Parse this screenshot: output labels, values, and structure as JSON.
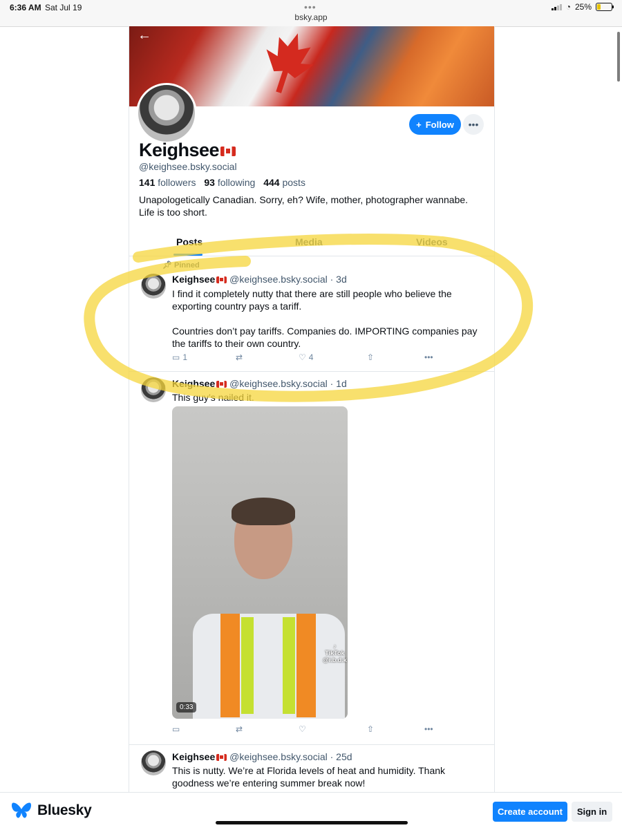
{
  "status_bar": {
    "time": "6:36 AM",
    "date": "Sat Jul 19",
    "dots": "•••",
    "url": "bsky.app",
    "battery": "25%",
    "battery_level_fraction": 0.25
  },
  "profile": {
    "display_name": "Keighsee",
    "handle": "@keighsee.bsky.social",
    "follow_label": "Follow",
    "stats": {
      "followers_count": "141",
      "followers_label": "followers",
      "following_count": "93",
      "following_label": "following",
      "posts_count": "444",
      "posts_label": "posts"
    },
    "bio": "Unapologetically Canadian. Sorry, eh? Wife, mother, photographer wannabe. Life is too short."
  },
  "tabs": [
    {
      "label": "Posts",
      "active": true
    },
    {
      "label": "Media",
      "active": false
    },
    {
      "label": "Videos",
      "active": false
    }
  ],
  "posts": [
    {
      "pinned_label": "Pinned",
      "author": "Keighsee",
      "handle": "@keighsee.bsky.social",
      "time": "· 3d",
      "text": "I find it completely nutty that there are still people who believe the exporting country pays a tariff.\n\nCountries don’t pay tariffs. Companies do. IMPORTING companies pay the tariffs to their own country.",
      "replies": "1",
      "likes": "4"
    },
    {
      "author": "Keighsee",
      "handle": "@keighsee.bsky.social",
      "time": "· 1d",
      "text": "This guy’s nailed it.",
      "video_duration": "0:33",
      "video_watermark": "TikTok",
      "video_watermark_handle": "@i.b.d.k"
    },
    {
      "author": "Keighsee",
      "handle": "@keighsee.bsky.social",
      "time": "· 25d",
      "text": "This is nutty. We’re at Florida levels of heat and humidity. Thank goodness we’re entering summer break now!"
    }
  ],
  "bottom_bar": {
    "brand": "Bluesky",
    "create_account": "Create account",
    "sign_in": "Sign in"
  },
  "colors": {
    "accent": "#1083fe",
    "highlighter": "#f6d63c",
    "muted_text": "#42576c"
  }
}
